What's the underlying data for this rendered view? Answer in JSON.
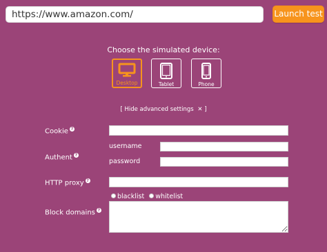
{
  "url_bar": {
    "value": "https://www.amazon.com/"
  },
  "launch_button": {
    "label": "Launch test"
  },
  "device_selector": {
    "title": "Choose the simulated device:",
    "devices": [
      {
        "label": "Desktop",
        "icon": "desktop-icon",
        "selected": true
      },
      {
        "label": "Tablet",
        "icon": "tablet-icon",
        "selected": false
      },
      {
        "label": "Phone",
        "icon": "phone-icon",
        "selected": false
      }
    ]
  },
  "advanced": {
    "open_bracket": "[",
    "label": "Hide advanced settings",
    "close_icon": "✕",
    "close_bracket": "]"
  },
  "settings": {
    "cookie_label": "Cookie",
    "cookie_value": "",
    "auth_label": "Authent",
    "username_label": "username",
    "username_value": "",
    "password_label": "password",
    "password_value": "",
    "proxy_label": "HTTP proxy",
    "proxy_value": "",
    "block_label": "Block domains",
    "block_value": "",
    "blacklist_label": "blacklist",
    "whitelist_label": "whitelist",
    "help_glyph": "?"
  },
  "colors": {
    "background": "#9b4478",
    "accent": "#f7941d",
    "text": "#ffffff"
  }
}
